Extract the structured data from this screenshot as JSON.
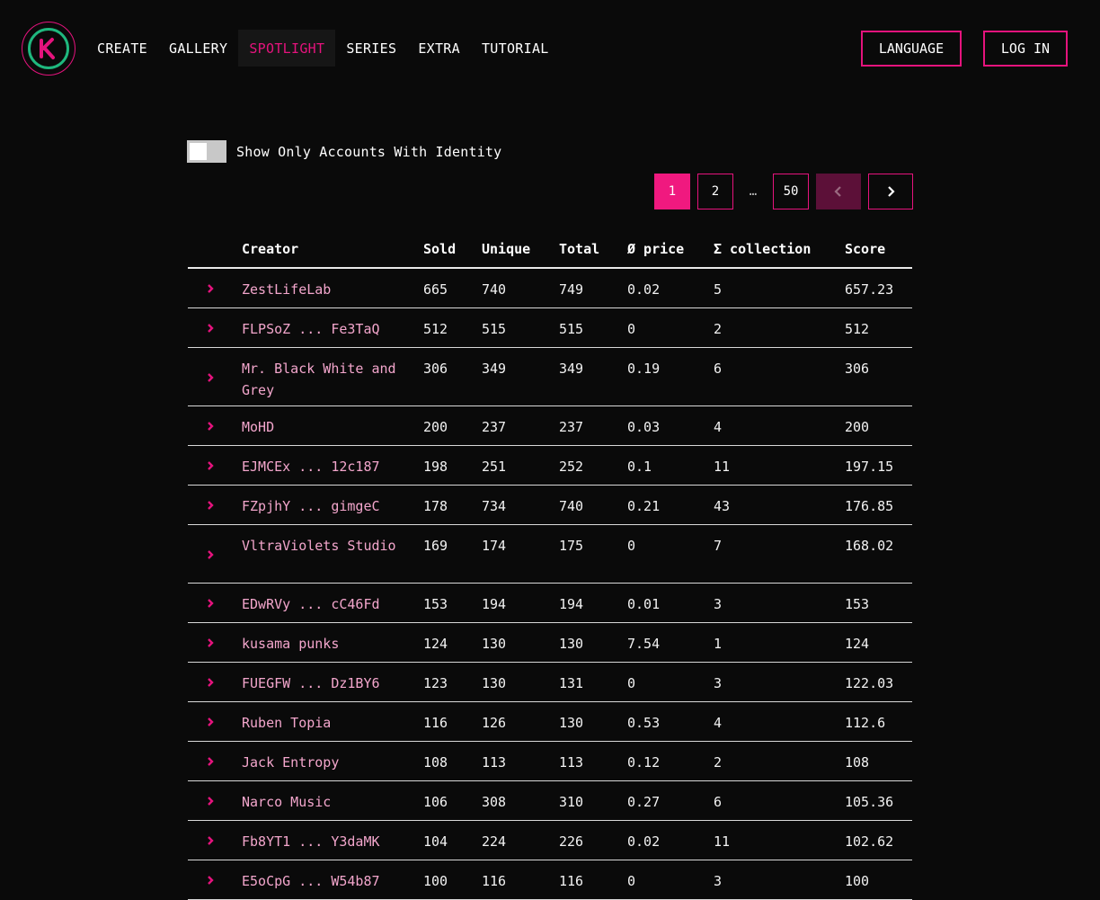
{
  "nav": {
    "items": [
      {
        "label": "CREATE"
      },
      {
        "label": "GALLERY"
      },
      {
        "label": "SPOTLIGHT"
      },
      {
        "label": "SERIES"
      },
      {
        "label": "EXTRA"
      },
      {
        "label": "TUTORIAL"
      }
    ],
    "active": "SPOTLIGHT",
    "language_label": "LANGUAGE",
    "login_label": "LOG IN"
  },
  "filter": {
    "toggle_label": "Show Only Accounts With Identity",
    "toggle_on": false
  },
  "pagination": {
    "pages": [
      "1",
      "2",
      "…",
      "50"
    ],
    "current": "1",
    "prev_icon": "chevron-left-icon",
    "next_icon": "chevron-right-icon"
  },
  "table": {
    "headers": {
      "creator": "Creator",
      "sold": "Sold",
      "unique": "Unique",
      "total": "Total",
      "price": "Ø price",
      "collection": "Σ collection",
      "score": "Score"
    },
    "rows": [
      {
        "creator": "ZestLifeLab",
        "sold": "665",
        "unique": "740",
        "total": "749",
        "price": "0.02",
        "collection": "5",
        "score": "657.23"
      },
      {
        "creator": "FLPSoZ ... Fe3TaQ",
        "sold": "512",
        "unique": "515",
        "total": "515",
        "price": "0",
        "collection": "2",
        "score": "512"
      },
      {
        "creator": "Mr. Black White and Grey",
        "sold": "306",
        "unique": "349",
        "total": "349",
        "price": "0.19",
        "collection": "6",
        "score": "306"
      },
      {
        "creator": "MoHD",
        "sold": "200",
        "unique": "237",
        "total": "237",
        "price": "0.03",
        "collection": "4",
        "score": "200"
      },
      {
        "creator": "EJMCEx ... 12c187",
        "sold": "198",
        "unique": "251",
        "total": "252",
        "price": "0.1",
        "collection": "11",
        "score": "197.15"
      },
      {
        "creator": "FZpjhY ... gimgeC",
        "sold": "178",
        "unique": "734",
        "total": "740",
        "price": "0.21",
        "collection": "43",
        "score": "176.85"
      },
      {
        "creator": "VltraViolets Studio",
        "sold": "169",
        "unique": "174",
        "total": "175",
        "price": "0",
        "collection": "7",
        "score": "168.02"
      },
      {
        "creator": "EDwRVy ... cC46Fd",
        "sold": "153",
        "unique": "194",
        "total": "194",
        "price": "0.01",
        "collection": "3",
        "score": "153"
      },
      {
        "creator": "kusama punks",
        "sold": "124",
        "unique": "130",
        "total": "130",
        "price": "7.54",
        "collection": "1",
        "score": "124"
      },
      {
        "creator": "FUEGFW ... Dz1BY6",
        "sold": "123",
        "unique": "130",
        "total": "131",
        "price": "0",
        "collection": "3",
        "score": "122.03"
      },
      {
        "creator": "Ruben Topia",
        "sold": "116",
        "unique": "126",
        "total": "130",
        "price": "0.53",
        "collection": "4",
        "score": "112.6"
      },
      {
        "creator": "Jack Entropy",
        "sold": "108",
        "unique": "113",
        "total": "113",
        "price": "0.12",
        "collection": "2",
        "score": "108"
      },
      {
        "creator": "Narco Music",
        "sold": "106",
        "unique": "308",
        "total": "310",
        "price": "0.27",
        "collection": "6",
        "score": "105.36"
      },
      {
        "creator": "Fb8YT1 ... Y3daMK",
        "sold": "104",
        "unique": "224",
        "total": "226",
        "price": "0.02",
        "collection": "11",
        "score": "102.62"
      },
      {
        "creator": "E5oCpG ... W54b87",
        "sold": "100",
        "unique": "116",
        "total": "116",
        "price": "0",
        "collection": "3",
        "score": "100"
      }
    ]
  },
  "colors": {
    "accent": "#e5137d",
    "background": "#0a0a0a",
    "creator_link": "#f3a6cc",
    "logo_ring": "#1fb87e"
  }
}
